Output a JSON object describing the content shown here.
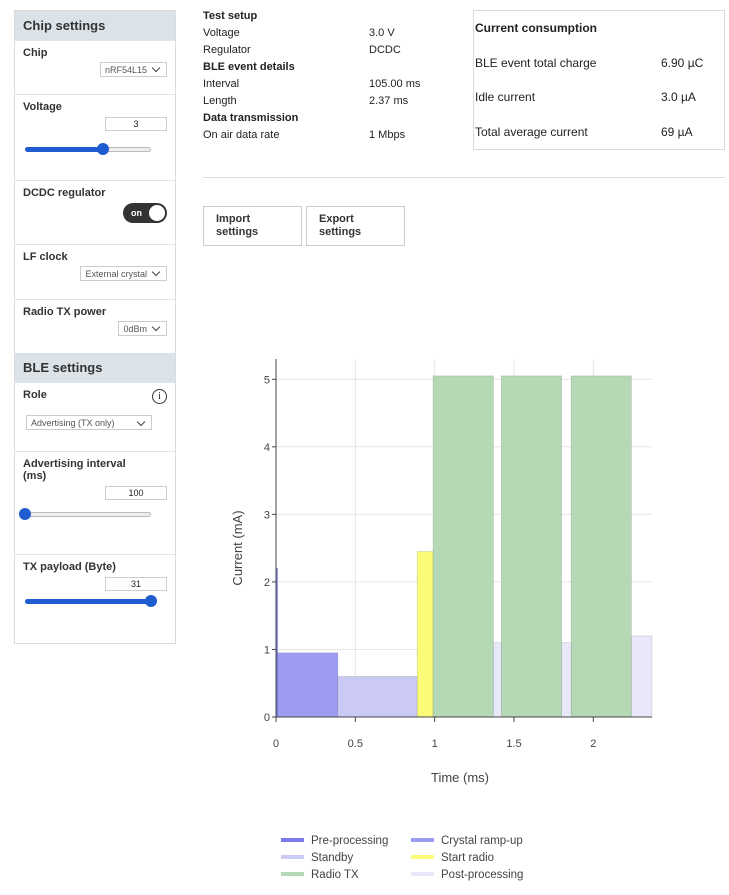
{
  "sidebar": {
    "chip_header": "Chip settings",
    "chip_label": "Chip",
    "chip_value": "nRF54L15",
    "voltage_label": "Voltage",
    "voltage_value": "3",
    "voltage_slider_fraction": 0.62,
    "dcdc_label": "DCDC regulator",
    "dcdc_toggle": "on",
    "lf_label": "LF clock",
    "lf_value": "External crystal",
    "tx_label": "Radio TX power",
    "tx_value": "0dBm",
    "ble_header": "BLE settings",
    "role_label": "Role",
    "role_value": "Advertising (TX only)",
    "adv_label": "Advertising interval (ms)",
    "adv_value": "100",
    "adv_slider_fraction": 0.0,
    "payload_label": "TX payload (Byte)",
    "payload_value": "31",
    "payload_slider_fraction": 1.0
  },
  "details": {
    "test_setup": "Test setup",
    "voltage_label": "Voltage",
    "voltage_value": "3.0 V",
    "regulator_label": "Regulator",
    "regulator_value": "DCDC",
    "ble_event": "BLE event details",
    "interval_label": "Interval",
    "interval_value": "105.00 ms",
    "length_label": "Length",
    "length_value": "2.37 ms",
    "data_tx": "Data transmission",
    "rate_label": "On air data rate",
    "rate_value": "1 Mbps"
  },
  "consumption": {
    "title": "Current consumption",
    "charge_label": "BLE event total charge",
    "charge_value": "6.90 µC",
    "idle_label": "Idle current",
    "idle_value": "3.0 µA",
    "avg_label": "Total average current",
    "avg_value": "69 µA"
  },
  "buttons": {
    "import": "Import settings",
    "export": "Export settings"
  },
  "chart_data": {
    "type": "bar",
    "xlabel": "Time (ms)",
    "ylabel": "Current (mA)",
    "xlim": [
      0,
      2.37
    ],
    "ylim": [
      0,
      5.3
    ],
    "x_ticks": [
      "0",
      "0.5",
      "1",
      "1.5",
      "2"
    ],
    "y_ticks": [
      "0",
      "1",
      "2",
      "3",
      "4",
      "5"
    ],
    "grid": true,
    "legend": "bottom",
    "series": [
      {
        "name": "Pre-processing",
        "color": "#7b7bf0",
        "segments": [
          [
            0,
            0.01,
            2.2
          ]
        ]
      },
      {
        "name": "Crystal ramp-up",
        "color": "#9c9cf2",
        "segments": [
          [
            0.01,
            0.39,
            0.95
          ]
        ]
      },
      {
        "name": "Standby",
        "color": "#cacaf4",
        "segments": [
          [
            0.39,
            0.89,
            0.6
          ]
        ]
      },
      {
        "name": "Start radio",
        "color": "#fbfb7a",
        "segments": [
          [
            0.89,
            0.99,
            2.45
          ]
        ]
      },
      {
        "name": "Radio TX",
        "color": "#b4d9b4",
        "segments": [
          [
            0.99,
            1.37,
            5.05
          ],
          [
            1.42,
            1.8,
            5.05
          ],
          [
            1.86,
            2.24,
            5.05
          ]
        ]
      },
      {
        "name": "Post-processing",
        "color": "#e8e8f8",
        "segments": [
          [
            1.37,
            1.42,
            1.1
          ],
          [
            1.8,
            1.86,
            1.1
          ],
          [
            2.24,
            2.37,
            1.2
          ]
        ]
      }
    ]
  }
}
